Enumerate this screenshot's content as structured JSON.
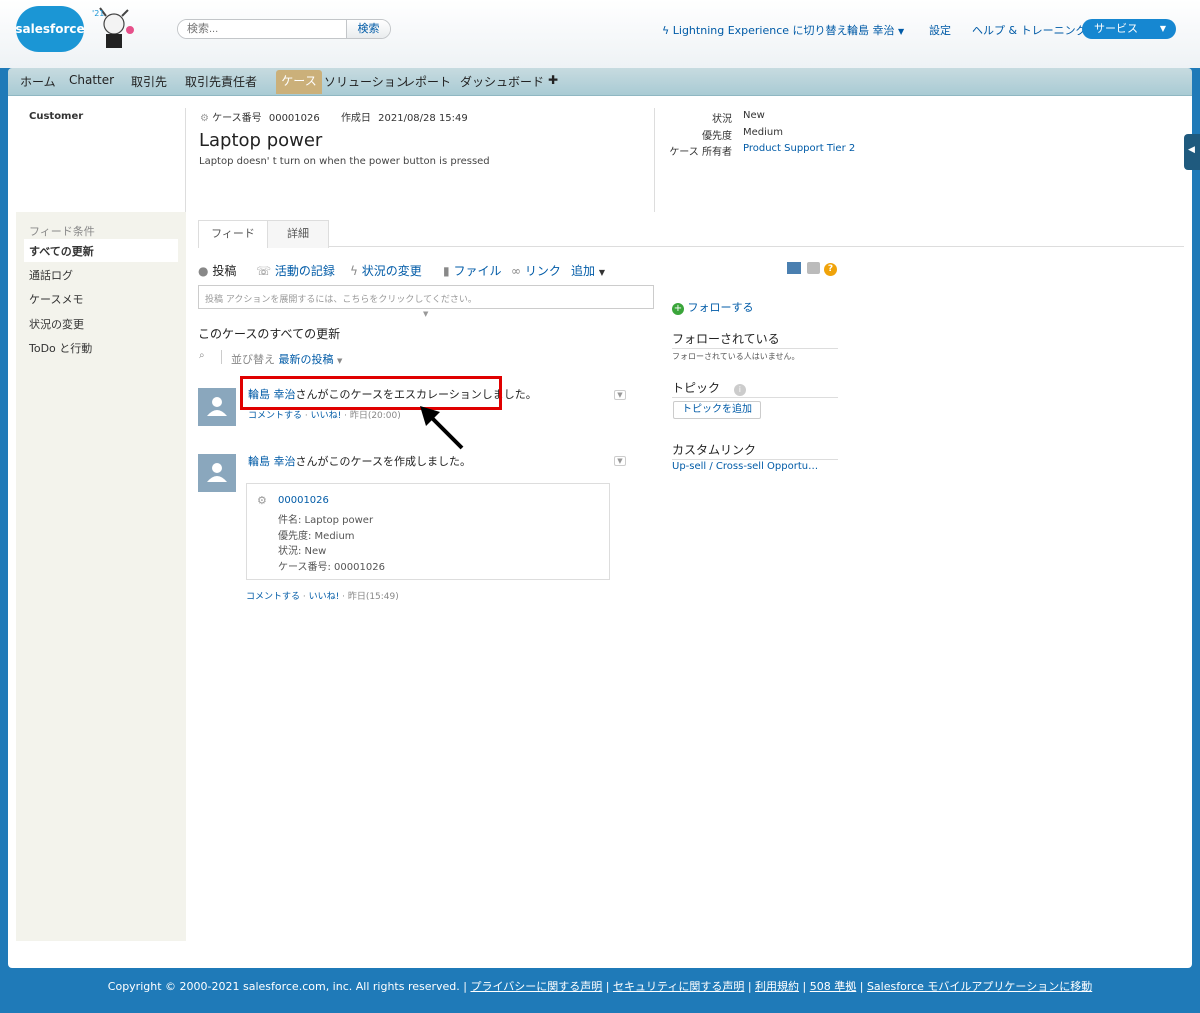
{
  "header": {
    "logo_text": "salesforce",
    "search_placeholder": "検索...",
    "search_button": "検索",
    "lightning_switch": "Lightning Experience に切り替え",
    "user_name": "輪島 幸治",
    "setup": "設定",
    "help": "ヘルプ & トレーニング",
    "app_menu": "サービス"
  },
  "tabs": [
    "ホーム",
    "Chatter",
    "取引先",
    "取引先責任者",
    "ケース",
    "ソリューション",
    "レポート",
    "ダッシュボード",
    "✚"
  ],
  "case": {
    "account": "Customer",
    "number_label": "ケース番号",
    "number": "00001026",
    "created_label": "作成日",
    "created": "2021/08/28 15:49",
    "title": "Laptop power",
    "description": "Laptop doesn' t turn on when the power button is pressed",
    "status_label": "状況",
    "status": "New",
    "priority_label": "優先度",
    "priority": "Medium",
    "owner_label": "ケース 所有者",
    "owner": "Product Support Tier 2"
  },
  "sidebar": {
    "heading": "フィード条件",
    "items": [
      "すべての更新",
      "通話ログ",
      "ケースメモ",
      "状況の変更",
      "ToDo と行動"
    ]
  },
  "feed_tabs": [
    "フィード",
    "詳細"
  ],
  "publisher": {
    "actions": [
      "投稿",
      "活動の記録",
      "状況の変更",
      "ファイル",
      "リンク",
      "追加"
    ],
    "placeholder": "投稿 アクションを展開するには、こちらをクリックしてください。"
  },
  "feed": {
    "heading": "このケースのすべての更新",
    "sort_label": "並び替え",
    "sort_value": "最新の投稿",
    "items": [
      {
        "user": "輪島 幸治",
        "text": "さんがこのケースをエスカレーションしました。",
        "comment": "コメントする",
        "like": "いいね!",
        "time": "昨日(20:00)"
      },
      {
        "user": "輪島 幸治",
        "text": "さんがこのケースを作成しました。",
        "comment": "コメントする",
        "like": "いいね!",
        "time": "昨日(15:49)"
      }
    ],
    "card": {
      "number": "00001026",
      "subject": "件名: Laptop power",
      "priority": "優先度: Medium",
      "status": "状況: New",
      "case_number": "ケース番号: 00001026"
    }
  },
  "right_panel": {
    "follow": "フォローする",
    "followers_heading": "フォローされている",
    "followers_empty": "フォローされている人はいません。",
    "topics_heading": "トピック",
    "add_topic": "トピックを追加",
    "custom_links_heading": "カスタムリンク",
    "custom_link": "Up-sell / Cross-sell Opportu…"
  },
  "footer": {
    "copyright": "Copyright © 2000-2021 salesforce.com, inc. All rights reserved.",
    "links": [
      "プライバシーに関する声明",
      "セキュリティに関する声明",
      "利用規約",
      "508 準拠",
      "Salesforce モバイルアプリケーションに移動"
    ]
  },
  "colors": {
    "brand": "#1b96d5",
    "link": "#015ba7",
    "active_tab": "#cbb07a",
    "highlight": "#e00000",
    "page_bg": "#1f7ab8"
  }
}
